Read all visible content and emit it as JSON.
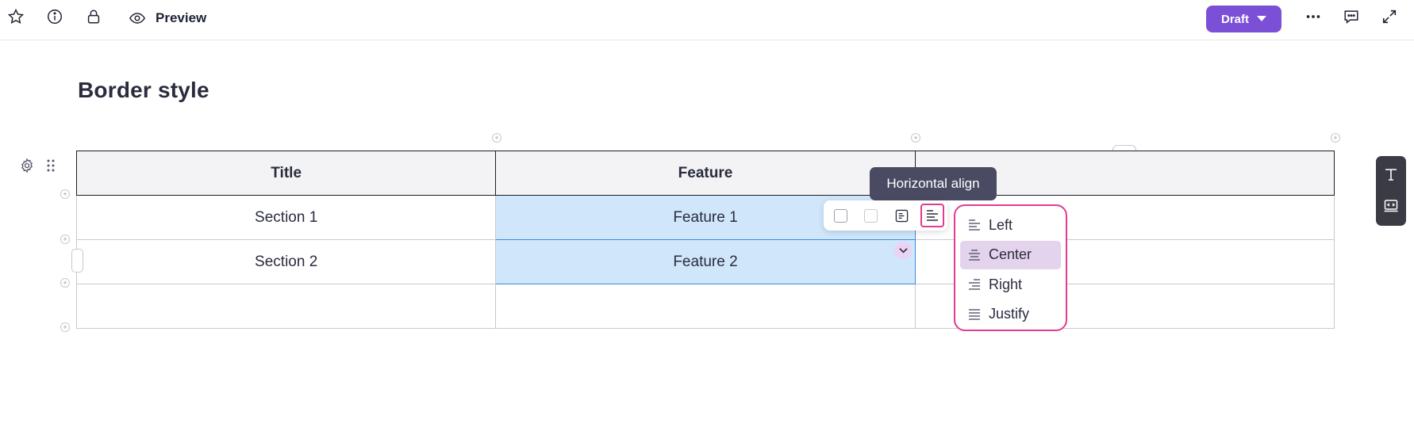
{
  "topbar": {
    "icons": [
      "star-icon",
      "info-icon",
      "lock-icon",
      "eye-icon",
      "more-icon",
      "comment-icon",
      "expand-icon"
    ],
    "preview_label": "Preview",
    "status_button": {
      "label": "Draft",
      "color": "#7b4fd6"
    }
  },
  "page": {
    "title": "Border style"
  },
  "table": {
    "headers": [
      "Title",
      "Feature",
      ""
    ],
    "rows": [
      [
        "Section 1",
        "Feature 1",
        ""
      ],
      [
        "Section 2",
        "Feature 2",
        ""
      ],
      [
        "",
        "",
        ""
      ]
    ],
    "selection_color": "#cfe6fb"
  },
  "cell_toolbar": {
    "tooltip": "Horizontal align",
    "buttons": [
      "border-toggle",
      "background-toggle",
      "vertical-align",
      "horizontal-align"
    ]
  },
  "align_menu": {
    "highlight_color": "#e23c8e",
    "selected": "Center",
    "items": [
      {
        "label": "Left",
        "icon": "align-left-icon"
      },
      {
        "label": "Center",
        "icon": "align-center-icon"
      },
      {
        "label": "Right",
        "icon": "align-right-icon"
      },
      {
        "label": "Justify",
        "icon": "align-justify-icon"
      }
    ]
  },
  "side_panel": {
    "icons": [
      "text-icon",
      "embed-icon"
    ]
  }
}
